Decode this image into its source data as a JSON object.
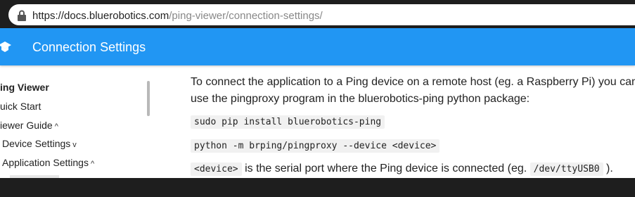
{
  "browser": {
    "url_host": "https://docs.bluerobotics.com",
    "url_path": "/ping-viewer/connection-settings/"
  },
  "header": {
    "title": "Connection Settings",
    "accent_color": "#2196f3"
  },
  "sidebar": {
    "items": [
      {
        "label": "ing Viewer"
      },
      {
        "label": "uick Start"
      },
      {
        "label": "iewer Guide",
        "chevron": "^"
      },
      {
        "label": "Device Settings",
        "chevron": "v"
      },
      {
        "label": "Application Settings",
        "chevron": "^"
      }
    ]
  },
  "content": {
    "paragraph1_line1": "To connect the application to a Ping device on a remote host (eg. a Raspberry Pi) you can",
    "paragraph1_line2": "use the pingproxy program in the bluerobotics-ping python package:",
    "code1": "sudo pip install bluerobotics-ping",
    "code2": "python -m brping/pingproxy --device <device>",
    "para2_code": "<device>",
    "para2_text": " is the serial port where the Ping device is connected (eg. ",
    "para2_code2": "/dev/ttyUSB0",
    "para2_end": " )."
  }
}
